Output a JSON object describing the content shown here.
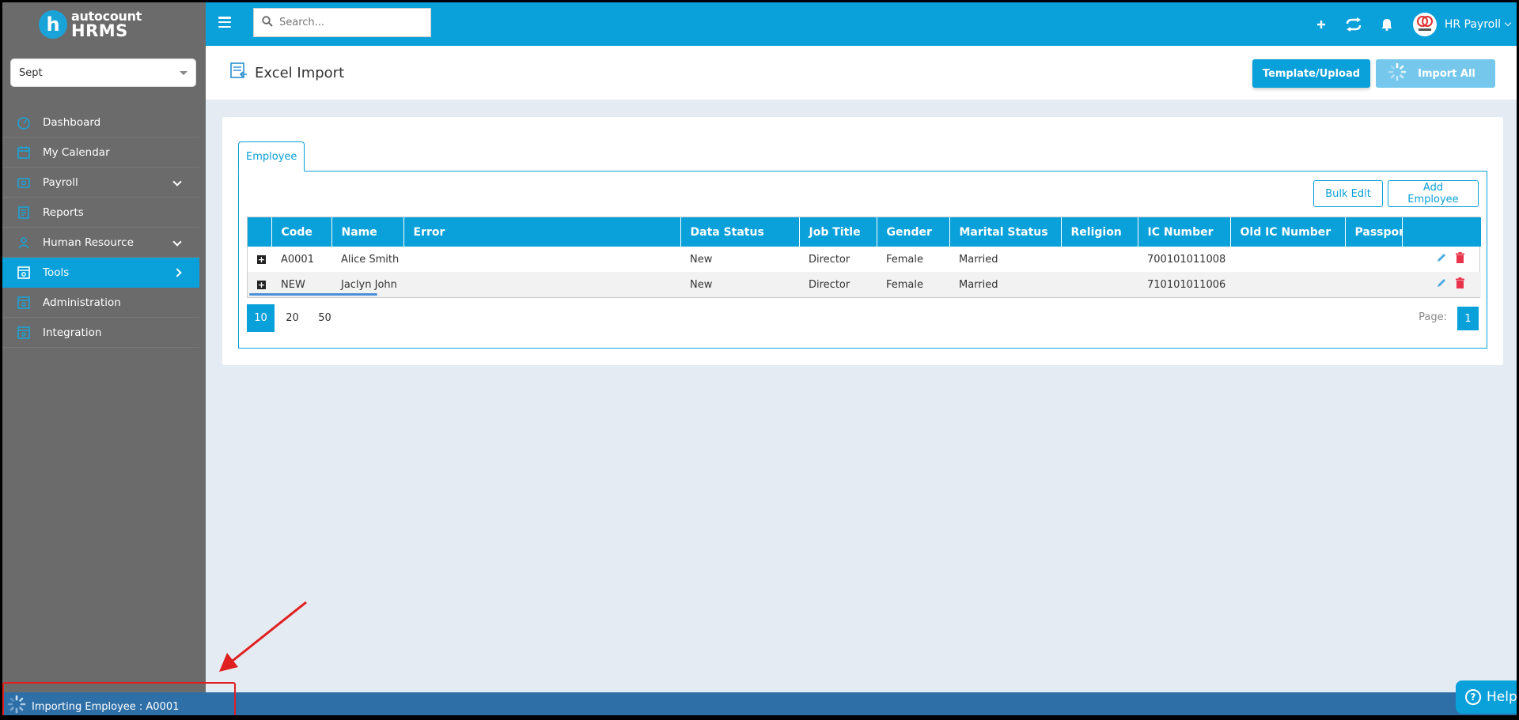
{
  "app": {
    "logo_top": "autocount",
    "logo_bottom": "HRMS",
    "logo_letter": "h"
  },
  "sidebar": {
    "period_selected": "Sept",
    "items": [
      {
        "label": "Dashboard",
        "icon": "dashboard-icon"
      },
      {
        "label": "My Calendar",
        "icon": "calendar-icon"
      },
      {
        "label": "Payroll",
        "icon": "payroll-icon"
      },
      {
        "label": "Reports",
        "icon": "reports-icon"
      },
      {
        "label": "Human Resource",
        "icon": "human-resource-icon"
      },
      {
        "label": "Tools",
        "icon": "tools-icon"
      },
      {
        "label": "Administration",
        "icon": "administration-icon"
      },
      {
        "label": "Integration",
        "icon": "integration-icon"
      }
    ],
    "active_item": "Tools"
  },
  "topbar": {
    "search_placeholder": "Search...",
    "user_name": "HR Payroll"
  },
  "page": {
    "title": "Excel Import",
    "template_upload_label": "Template/Upload",
    "import_all_label": "Import All"
  },
  "tabs": {
    "employee": "Employee"
  },
  "toolbar": {
    "bulk_edit_label": "Bulk Edit",
    "add_employee_label": "Add Employee"
  },
  "table": {
    "columns": [
      "Code",
      "Name",
      "Error",
      "Data Status",
      "Job Title",
      "Gender",
      "Marital Status",
      "Religion",
      "IC Number",
      "Old IC Number",
      "Passport"
    ],
    "rows": [
      {
        "code": "A0001",
        "name": "Alice Smith",
        "error": "",
        "data_status": "New",
        "job_title": "Director",
        "gender": "Female",
        "marital_status": "Married",
        "religion": "",
        "ic_number": "700101011008",
        "old_ic_number": "",
        "passport": ""
      },
      {
        "code": "NEW",
        "name": "Jaclyn John",
        "error": "",
        "data_status": "New",
        "job_title": "Director",
        "gender": "Female",
        "marital_status": "Married",
        "religion": "",
        "ic_number": "710101011006",
        "old_ic_number": "",
        "passport": ""
      }
    ]
  },
  "pager": {
    "sizes": [
      "10",
      "20",
      "50"
    ],
    "selected_size": "10",
    "page_label": "Page:",
    "current_page": "1"
  },
  "status": {
    "text": "Importing Employee : A0001"
  },
  "help": {
    "label": "Help"
  },
  "colors": {
    "accent": "#0aa0d9",
    "sidebar_bg": "#6b6b6b",
    "status_new": "#2eb86f",
    "delete": "#e8334a"
  }
}
